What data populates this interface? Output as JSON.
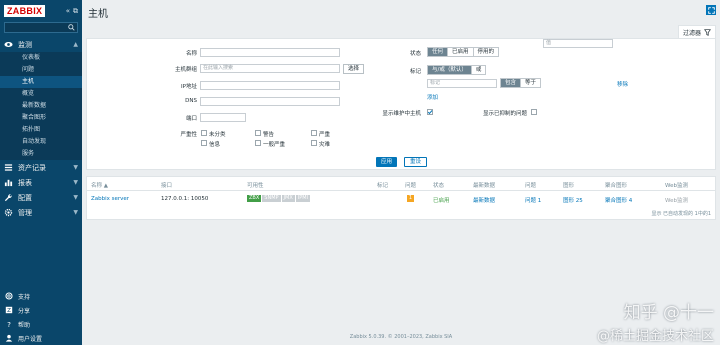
{
  "sidebar": {
    "logo": "ZABBIX",
    "collapse_icon": "«",
    "expand_icon": "⧉",
    "sections": [
      {
        "icon": "eye-icon",
        "label": "监测",
        "arrow": "▲"
      },
      {
        "icon": "list-icon",
        "label": "资产记录",
        "arrow": "▼"
      },
      {
        "icon": "chart-icon",
        "label": "报表",
        "arrow": "▼"
      },
      {
        "icon": "wrench-icon",
        "label": "配置",
        "arrow": "▼"
      },
      {
        "icon": "gear-icon",
        "label": "管理",
        "arrow": "▼"
      }
    ],
    "submenu": [
      "仪表板",
      "问题",
      "主机",
      "概览",
      "最新数据",
      "聚合图形",
      "拓扑图",
      "自动发现",
      "服务"
    ],
    "current_sub": "主机",
    "bottom": [
      {
        "icon": "support-icon",
        "label": "支持"
      },
      {
        "icon": "share-icon",
        "label": "分享"
      },
      {
        "icon": "help-icon",
        "label": "帮助"
      },
      {
        "icon": "user-icon",
        "label": "用户设置"
      }
    ]
  },
  "header": {
    "title": "主机",
    "filter_label": "过滤器"
  },
  "filter": {
    "name_label": "名称",
    "group_label": "主机群组",
    "group_placeholder": "在此输入搜索",
    "select_btn": "选择",
    "ip_label": "IP地址",
    "dns_label": "DNS",
    "port_label": "端口",
    "severity_label": "严重性",
    "severities": [
      "未分类",
      "警告",
      "严重",
      "信息",
      "一般严重",
      "灾难"
    ],
    "status_label": "状态",
    "status_options": [
      "任何",
      "已启用",
      "停用的"
    ],
    "tags_label": "标记",
    "tag_options": [
      "与/或（默认）",
      "或"
    ],
    "tag_placeholder": "标记",
    "tag_op1": "包含",
    "tag_op2": "等于",
    "value_placeholder": "值",
    "remove": "移除",
    "add": "添加",
    "maintenance_label": "显示维护中主机",
    "suppressed_label": "显示已抑制的问题",
    "apply": "应用",
    "reset": "重设"
  },
  "table": {
    "headers": [
      "名称 ▲",
      "接口",
      "可用性",
      "标记",
      "问题",
      "状态",
      "最新数据",
      "问题",
      "图形",
      "聚合图形",
      "Web监测"
    ],
    "row": {
      "name": "Zabbix server",
      "interface": "127.0.0.1: 10050",
      "avail_zbx": "ZBX",
      "avail_snmp": "SNMP",
      "avail_jmx": "JMX",
      "avail_ipmi": "IPMI",
      "problems": "1",
      "status": "已启用",
      "latest": "最新数据",
      "issues": "问题 1",
      "graphs": "图形 25",
      "screens": "聚合图形 4",
      "web": "Web监测"
    },
    "count": "显示 已自动发现的 1中的1"
  },
  "footer": "Zabbix 5.0.39. © 2001–2023, Zabbix SIA",
  "watermark": {
    "line1": "知乎 @十一",
    "line2": "@稀土掘金技术社区"
  },
  "colors": {
    "sidebar": "#0a466a",
    "accent": "#0275b8",
    "enabled": "#429e47"
  }
}
